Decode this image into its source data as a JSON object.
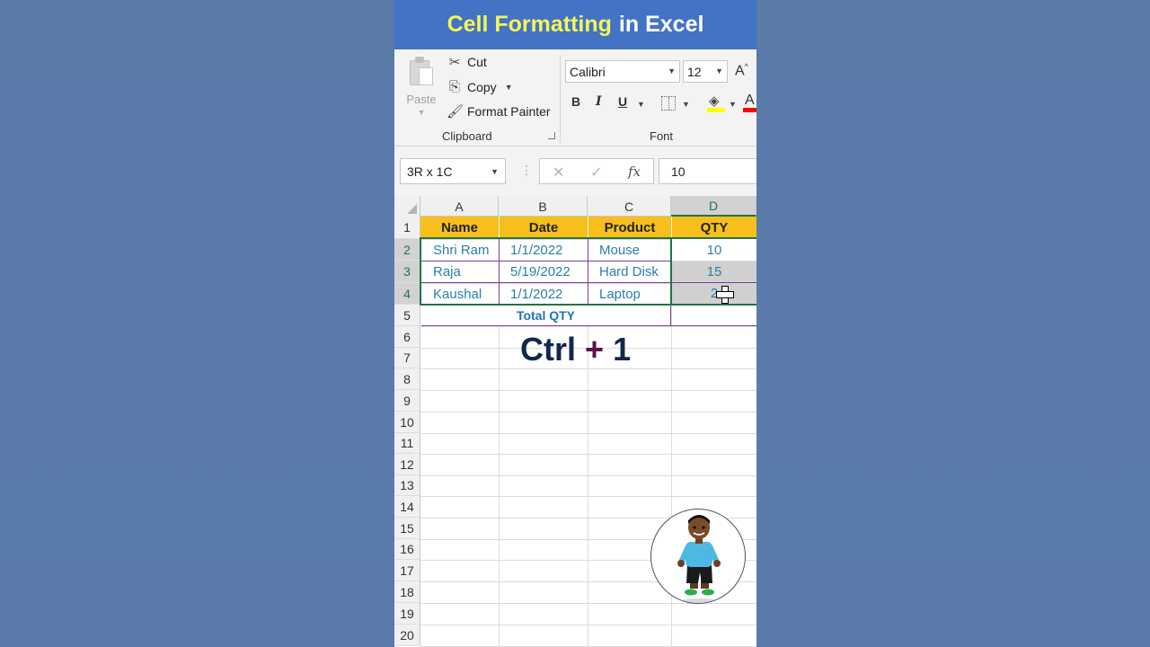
{
  "video": {
    "title_highlight": "Cell Formatting",
    "title_rest": "in Excel",
    "shortcut_left": "Ctrl",
    "shortcut_plus": "+",
    "shortcut_right": "1"
  },
  "ribbon": {
    "paste_label": "Paste",
    "cut_label": "Cut",
    "copy_label": "Copy",
    "format_painter_label": "Format Painter",
    "clipboard_group": "Clipboard",
    "font_group": "Font",
    "font_name": "Calibri",
    "font_size": "12",
    "bold": "B",
    "italic": "I",
    "underline": "U",
    "grow_font": "A",
    "font_color_letter": "A",
    "fill_color": "#ffff00",
    "font_color": "#ff0000"
  },
  "formula_bar": {
    "name_box": "3R x 1C",
    "cancel": "✕",
    "enter": "✓",
    "fx": "fx",
    "value": "10"
  },
  "sheet": {
    "columns": [
      "A",
      "B",
      "C",
      "D"
    ],
    "rows": [
      "1",
      "2",
      "3",
      "4",
      "5",
      "6",
      "7",
      "8",
      "9",
      "10",
      "11",
      "12",
      "13",
      "14",
      "15",
      "16",
      "17",
      "18",
      "19",
      "20"
    ],
    "headers": [
      "Name",
      "Date",
      "Product",
      "QTY"
    ],
    "data": [
      [
        "Shri Ram",
        "1/1/2022",
        "Mouse",
        "10"
      ],
      [
        "Raja",
        "5/19/2022",
        "Hard Disk",
        "15"
      ],
      [
        "Kaushal",
        "1/1/2022",
        "Laptop",
        "2"
      ]
    ],
    "total_label": "Total QTY",
    "header_fill": "#f6bf1b",
    "selection_color": "#217346"
  }
}
